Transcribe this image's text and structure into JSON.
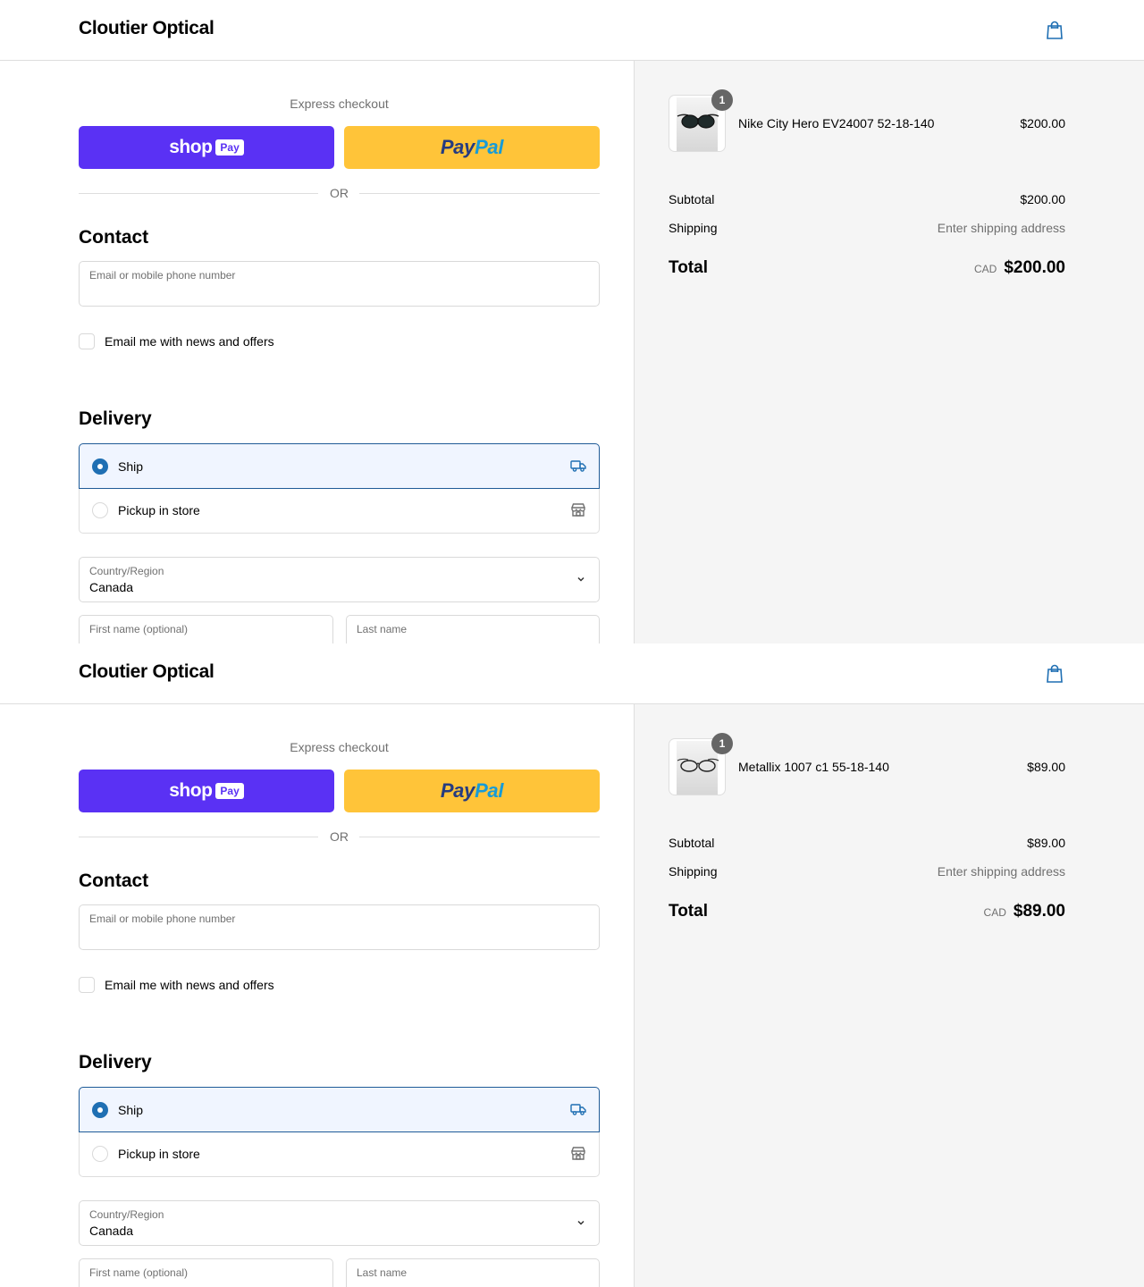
{
  "accent_color": "#1f6fb3",
  "frames": [
    {
      "header": {
        "brand": "Cloutier Optical",
        "cart_icon": "shopping-bag-icon"
      },
      "express": {
        "title": "Express checkout",
        "shop_label": "shop",
        "shop_badge": "Pay",
        "paypal_a": "Pay",
        "paypal_b": "Pal"
      },
      "or_label": "OR",
      "contact": {
        "title": "Contact",
        "email_label": "Email or mobile phone number",
        "email_value": "",
        "newsletter_label": "Email me with news and offers",
        "newsletter_checked": false
      },
      "delivery": {
        "title": "Delivery",
        "options": [
          {
            "label": "Ship",
            "selected": true,
            "icon": "truck-icon"
          },
          {
            "label": "Pickup in store",
            "selected": false,
            "icon": "store-icon"
          }
        ],
        "country_label": "Country/Region",
        "country_value": "Canada",
        "first_name_label": "First name (optional)",
        "last_name_label": "Last name"
      },
      "summary": {
        "item": {
          "name": "Nike City Hero EV24007 52-18-140",
          "price": "$200.00",
          "quantity": "1"
        },
        "subtotal_label": "Subtotal",
        "subtotal_value": "$200.00",
        "shipping_label": "Shipping",
        "shipping_value": "Enter shipping address",
        "total_label": "Total",
        "total_currency": "CAD",
        "total_value": "$200.00"
      }
    },
    {
      "header": {
        "brand": "Cloutier Optical",
        "cart_icon": "shopping-bag-icon"
      },
      "express": {
        "title": "Express checkout",
        "shop_label": "shop",
        "shop_badge": "Pay",
        "paypal_a": "Pay",
        "paypal_b": "Pal"
      },
      "or_label": "OR",
      "contact": {
        "title": "Contact",
        "email_label": "Email or mobile phone number",
        "email_value": "",
        "newsletter_label": "Email me with news and offers",
        "newsletter_checked": false
      },
      "delivery": {
        "title": "Delivery",
        "options": [
          {
            "label": "Ship",
            "selected": true,
            "icon": "truck-icon"
          },
          {
            "label": "Pickup in store",
            "selected": false,
            "icon": "store-icon"
          }
        ],
        "country_label": "Country/Region",
        "country_value": "Canada",
        "first_name_label": "First name (optional)",
        "last_name_label": "Last name"
      },
      "summary": {
        "item": {
          "name": "Metallix 1007 c1 55-18-140",
          "price": "$89.00",
          "quantity": "1"
        },
        "subtotal_label": "Subtotal",
        "subtotal_value": "$89.00",
        "shipping_label": "Shipping",
        "shipping_value": "Enter shipping address",
        "total_label": "Total",
        "total_currency": "CAD",
        "total_value": "$89.00"
      }
    }
  ]
}
